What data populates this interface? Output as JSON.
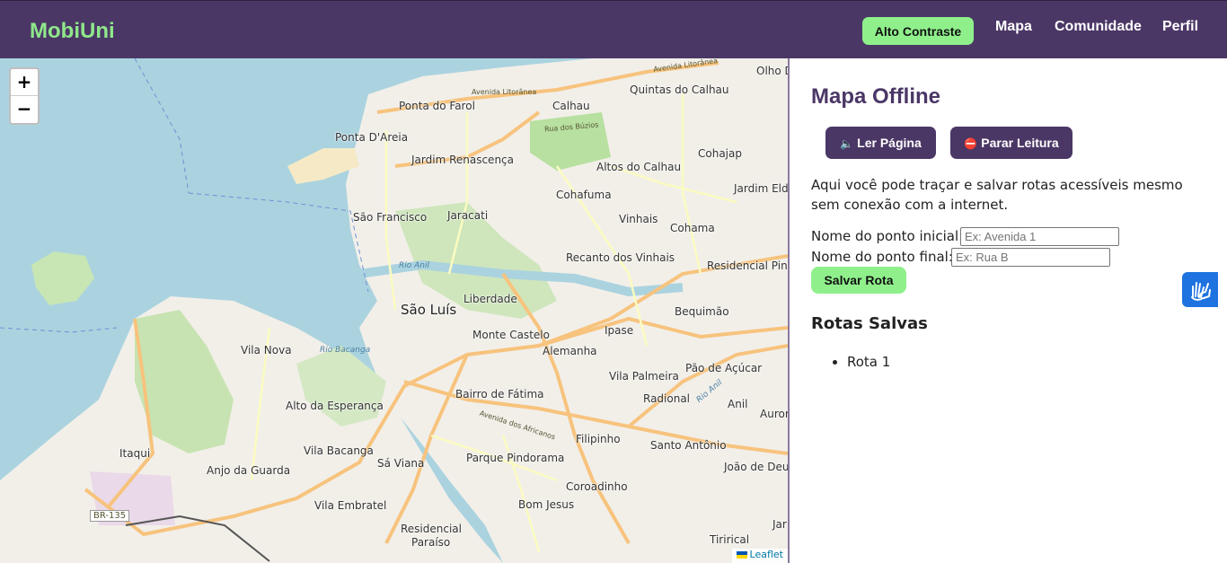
{
  "header": {
    "brand": "MobiUni",
    "contrast_label": "Alto Contraste",
    "nav": [
      "Mapa",
      "Comunidade",
      "Perfil"
    ]
  },
  "map": {
    "zoom_in": "+",
    "zoom_out": "−",
    "attribution": "Leaflet",
    "labels": {
      "sao_luis": "São Luís",
      "ponta_do_farol": "Ponta do Farol",
      "calhau": "Calhau",
      "quintas_do_calhau": "Quintas do Calhau",
      "olho_d": "Olho D",
      "ponta_d_areia": "Ponta D'Areia",
      "jardim_renascenca": "Jardim Renascença",
      "altos_do_calhau": "Altos do Calhau",
      "cohajap": "Cohajap",
      "cohafuma": "Cohafuma",
      "jardim_eldo": "Jardim Eldo",
      "sao_francisco": "São Francisco",
      "jaracati": "Jaracati",
      "vinhais": "Vinhais",
      "cohama": "Cohama",
      "recanto_dos_vinhais": "Recanto dos Vinhais",
      "residencial_pinheiros": "Residencial Pinheiros",
      "liberdade": "Liberdade",
      "bequimao": "Bequimão",
      "monte_castelo": "Monte Castelo",
      "ipase": "Ipase",
      "alemanha": "Alemanha",
      "vila_nova": "Vila Nova",
      "vila_palmeira": "Vila Palmeira",
      "pao_de_acucar": "Pão de Açúcar",
      "radional": "Radional",
      "anil": "Anil",
      "auror": "Auror",
      "bairro_de_fatima": "Bairro de Fátima",
      "alto_da_esperanca": "Alto da Esperança",
      "filipinho": "Filipinho",
      "santo_antonio": "Santo Antônio",
      "itaqui": "Itaqui",
      "vila_bacanga": "Vila Bacanga",
      "anjo_da_guarda": "Anjo da Guarda",
      "sa_viana": "Sá Viana",
      "parque_pindorama": "Parque Pindorama",
      "joao_de_deus": "João de Deus",
      "coroadinho": "Coroadinho",
      "vila_embratel": "Vila Embratel",
      "bom_jesus": "Bom Jesus",
      "residencial_paraiso_1": "Residencial",
      "residencial_paraiso_2": "Paraíso",
      "tirirical": "Tirirical",
      "jar": "Jar",
      "br_135": "BR-135",
      "rio_anil": "Rio Anil",
      "rio_bacanga": "Rio Bacanga",
      "rio_anil_2": "Rio Anil",
      "av_litoranea_1": "Avenida Litorânea",
      "av_litoranea_2": "Avenida Litorânea",
      "rua_dos_buzios": "Rua dos Búzios",
      "av_dos_africanos": "Avenida dos Africanos"
    }
  },
  "panel": {
    "title": "Mapa Offline",
    "read_page": "Ler Página",
    "stop_reading": "Parar Leitura",
    "description": "Aqui você pode traçar e salvar rotas acessíveis mesmo sem conexão com a internet.",
    "start_label": "Nome do ponto inicial:",
    "start_placeholder": "Ex: Avenida 1",
    "end_label": "Nome do ponto final:",
    "end_placeholder": "Ex: Rua B",
    "save_label": "Salvar Rota",
    "saved_title": "Rotas Salvas",
    "routes": [
      "Rota 1"
    ]
  }
}
